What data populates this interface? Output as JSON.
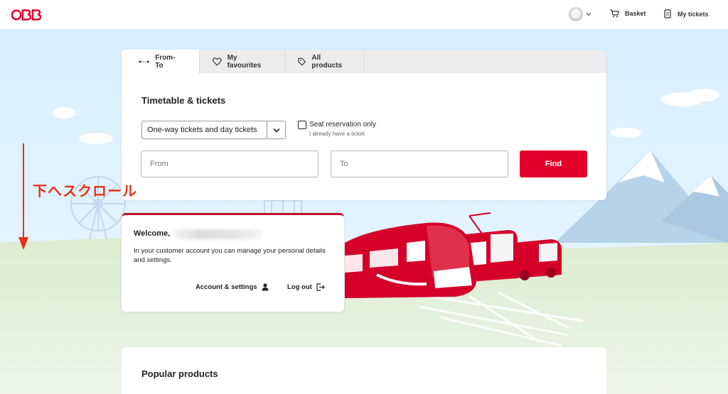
{
  "header": {
    "logo_alt": "ÖBB",
    "basket_label": "Basket",
    "tickets_label": "My tickets"
  },
  "tabs": [
    {
      "label": "From-To",
      "active": true
    },
    {
      "label": "My favourites",
      "active": false
    },
    {
      "label": "All products",
      "active": false
    }
  ],
  "search": {
    "title": "Timetable & tickets",
    "ticket_type": "One-way tickets and day tickets",
    "seat_label": "Seat reservation only",
    "seat_sublabel": "I already have a ticket",
    "from_placeholder": "From",
    "to_placeholder": "To",
    "find_label": "Find"
  },
  "welcome": {
    "greeting": "Welcome,",
    "text": "In your customer account you can manage your personal details and settings.",
    "account_label": "Account & settings",
    "logout_label": "Log out"
  },
  "popular": {
    "title": "Popular products"
  },
  "annotation": {
    "text": "下へスクロール"
  },
  "colors": {
    "brand_red": "#e2002a",
    "sky": "#dcefff",
    "grass": "#e3efd9"
  }
}
